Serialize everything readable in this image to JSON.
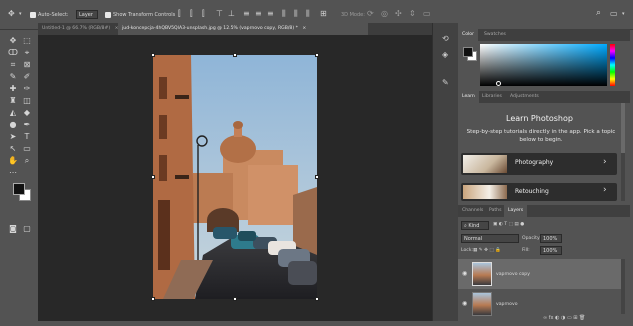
{
  "options_bar": {
    "auto_select_label": "Auto-Select:",
    "auto_select_value": "Layer",
    "transform_controls_label": "Show Transform Controls",
    "mode_label": "3D Mode:"
  },
  "tabs": [
    {
      "label": "Untitled-1 @ 66.7% (RGB/8#)",
      "active": false
    },
    {
      "label": "jud-koncepcja-4hQBV5QlA3-unsplash.jpg @ 12.5% (vaprnovo copy, RGB/8) *",
      "active": true
    }
  ],
  "color_panel": {
    "tabs": [
      "Color",
      "Swatches"
    ],
    "active_tab": "Color"
  },
  "learn_panel": {
    "tabs": [
      "Learn",
      "Libraries",
      "Adjustments"
    ],
    "active_tab": "Learn",
    "title": "Learn Photoshop",
    "description": "Step-by-step tutorials directly in the app. Pick a topic below to begin.",
    "items": [
      {
        "label": "Photography"
      },
      {
        "label": "Retouching"
      }
    ]
  },
  "layers_panel": {
    "tabs": [
      "Channels",
      "Paths",
      "Layers"
    ],
    "active_tab": "Layers",
    "filter_kind": "Kind",
    "blend_mode": "Normal",
    "opacity_label": "Opacity:",
    "opacity_value": "100%",
    "lock_label": "Lock:",
    "fill_label": "Fill:",
    "fill_value": "100%",
    "layers": [
      {
        "name": "vaprnovo copy",
        "selected": true
      },
      {
        "name": "vaprnovo",
        "selected": false
      }
    ]
  },
  "colors": {
    "accent_selected_layer": "#6a6a6a",
    "canvas_bg": "#282828",
    "panel_bg": "#535353"
  }
}
